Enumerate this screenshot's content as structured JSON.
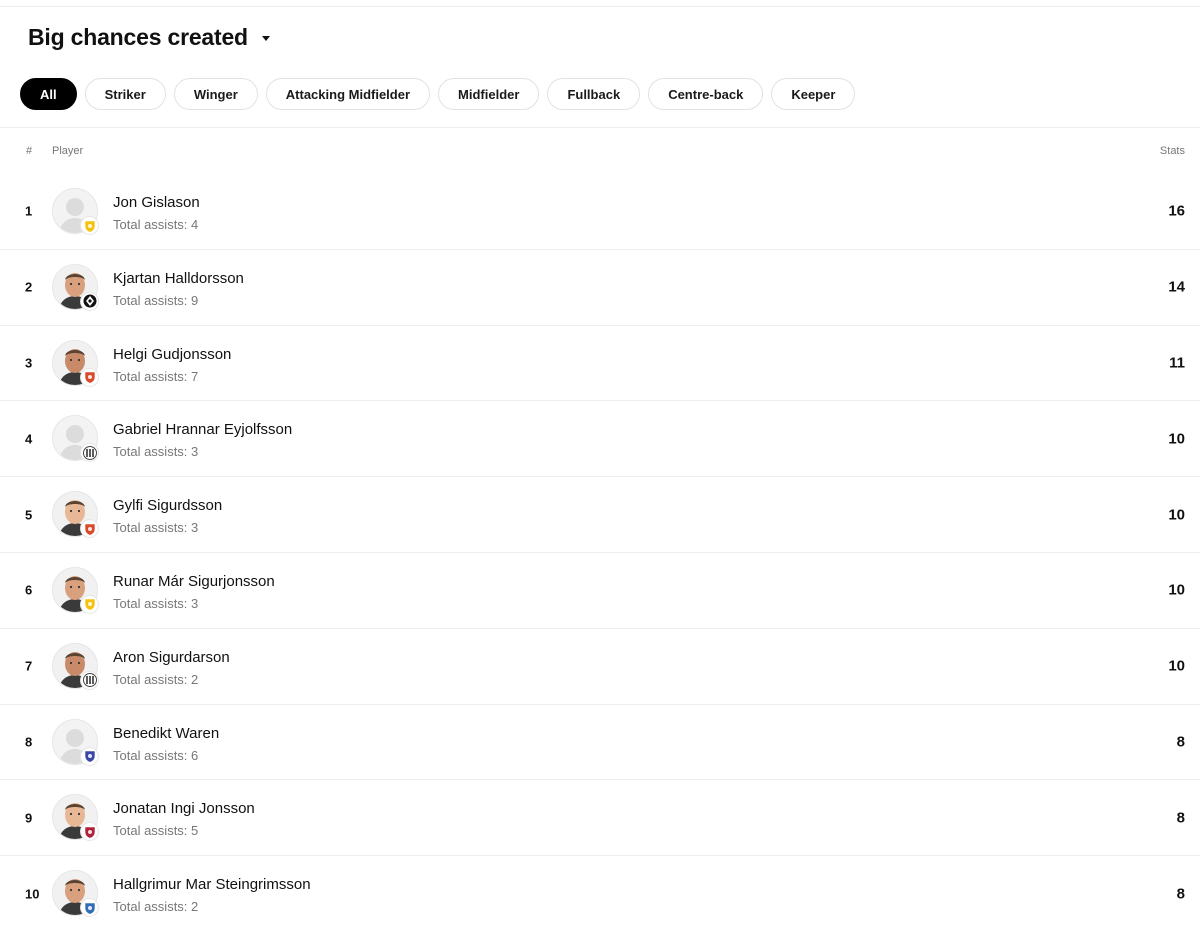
{
  "header": {
    "title": "Big chances created",
    "dropdown_icon": "caret-down-icon"
  },
  "filters": [
    {
      "label": "All",
      "active": true
    },
    {
      "label": "Striker",
      "active": false
    },
    {
      "label": "Winger",
      "active": false
    },
    {
      "label": "Attacking Midfielder",
      "active": false
    },
    {
      "label": "Midfielder",
      "active": false
    },
    {
      "label": "Fullback",
      "active": false
    },
    {
      "label": "Centre-back",
      "active": false
    },
    {
      "label": "Keeper",
      "active": false
    }
  ],
  "table": {
    "col_rank": "#",
    "col_player": "Player",
    "col_stats": "Stats",
    "assists_label": "Total assists:",
    "rows": [
      {
        "rank": "1",
        "name": "Jon Gislason",
        "assists": "4",
        "stat": "16",
        "avatar": "placeholder",
        "badge": "yellow-crest-icon",
        "badge_color": "#f4c20d"
      },
      {
        "rank": "2",
        "name": "Kjartan Halldorsson",
        "assists": "9",
        "stat": "14",
        "avatar": "photo",
        "badge": "black-white-crest-icon",
        "badge_color": "#111111"
      },
      {
        "rank": "3",
        "name": "Helgi Gudjonsson",
        "assists": "7",
        "stat": "11",
        "avatar": "photo",
        "badge": "red-crest-icon",
        "badge_color": "#d94a2b"
      },
      {
        "rank": "4",
        "name": "Gabriel Hrannar Eyjolfsson",
        "assists": "3",
        "stat": "10",
        "avatar": "placeholder",
        "badge": "striped-crest-icon",
        "badge_color": "#555555"
      },
      {
        "rank": "5",
        "name": "Gylfi Sigurdsson",
        "assists": "3",
        "stat": "10",
        "avatar": "photo",
        "badge": "red-crest-icon",
        "badge_color": "#d94a2b"
      },
      {
        "rank": "6",
        "name": "Runar Már Sigurjonsson",
        "assists": "3",
        "stat": "10",
        "avatar": "photo",
        "badge": "yellow-crest-icon",
        "badge_color": "#f4c20d"
      },
      {
        "rank": "7",
        "name": "Aron Sigurdarson",
        "assists": "2",
        "stat": "10",
        "avatar": "photo",
        "badge": "striped-crest-icon",
        "badge_color": "#555555"
      },
      {
        "rank": "8",
        "name": "Benedikt Waren",
        "assists": "6",
        "stat": "8",
        "avatar": "placeholder",
        "badge": "blue-crest-icon",
        "badge_color": "#3b47a8"
      },
      {
        "rank": "9",
        "name": "Jonatan Ingi Jonsson",
        "assists": "5",
        "stat": "8",
        "avatar": "photo",
        "badge": "maroon-crest-icon",
        "badge_color": "#b0203a"
      },
      {
        "rank": "10",
        "name": "Hallgrimur Mar Steingrimsson",
        "assists": "2",
        "stat": "8",
        "avatar": "photo",
        "badge": "blue-shield-icon",
        "badge_color": "#2f6db5"
      }
    ]
  }
}
